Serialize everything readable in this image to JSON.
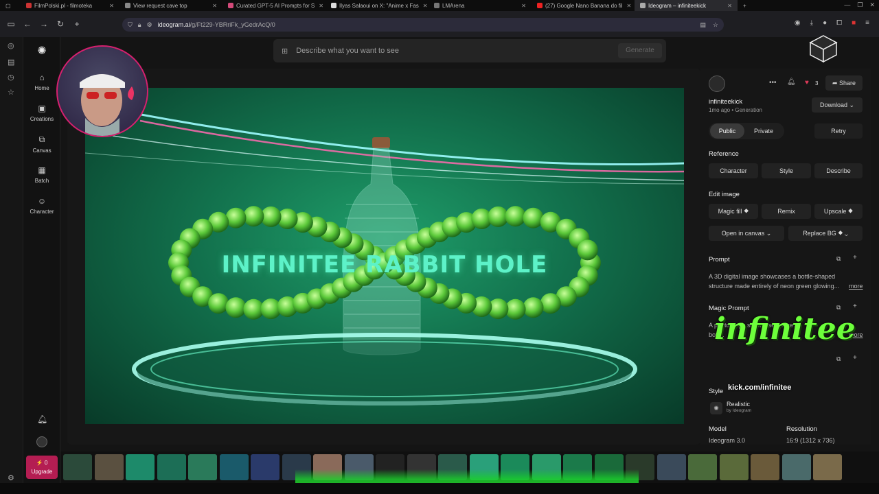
{
  "browser": {
    "tabs": [
      {
        "title": "FilmPolski.pl - filmoteka",
        "fav": "#c33"
      },
      {
        "title": "View request cave top",
        "fav": "#888"
      },
      {
        "title": "Curated GPT-5 AI Prompts for S",
        "fav": "#d44a7a"
      },
      {
        "title": "Ilyas Salaoui on X: \"Anime x Fas",
        "fav": "#ddd"
      },
      {
        "title": "LMArena",
        "fav": "#777"
      },
      {
        "title": "(27) Google Nano Banana do fil",
        "fav": "#e22"
      },
      {
        "title": "Ideogram – infiniteekick",
        "fav": "#aaa"
      }
    ],
    "url_host": "ideogram.ai",
    "url_path": "/g/Ft229-YBRriFk_yGedrAcQ/0"
  },
  "sidebar": {
    "items": [
      {
        "label": "Home",
        "icon": "home-icon",
        "glyph": "⌂"
      },
      {
        "label": "Creations",
        "icon": "image-icon",
        "glyph": "▣"
      },
      {
        "label": "Canvas",
        "icon": "canvas-icon",
        "glyph": "⧉"
      },
      {
        "label": "Batch",
        "icon": "batch-icon",
        "glyph": "▦"
      },
      {
        "label": "Character",
        "icon": "character-icon",
        "glyph": "☺"
      }
    ],
    "upgrade_count": "⚡ 0",
    "upgrade_label": "Upgrade"
  },
  "prompt": {
    "placeholder": "Describe what you want to see",
    "generate_label": "Generate"
  },
  "artwork": {
    "title": "INFINITEE RABBIT HOLE"
  },
  "panel": {
    "username": "infiniteekick",
    "meta": "1mo ago • Generation",
    "likes": "3",
    "share_label": "Share",
    "download_label": "Download",
    "public_label": "Public",
    "private_label": "Private",
    "retry_label": "Retry",
    "reference_heading": "Reference",
    "reference_buttons": [
      "Character",
      "Style",
      "Describe"
    ],
    "edit_heading": "Edit image",
    "edit_buttons": [
      "Magic fill ⯁",
      "Remix",
      "Upscale ⯁"
    ],
    "open_canvas_label": "Open in canvas",
    "replace_bg_label": "Replace BG ⯁",
    "prompt_heading": "Prompt",
    "prompt_line1": "A 3D digital image showcases a bottle-shaped",
    "prompt_line2": "structure made entirely of neon green glowing...",
    "more_label": "more",
    "magic_prompt_heading": "Magic Prompt",
    "magic_prompt_line1": "A photograph showcases a me...",
    "magic_prompt_line2": "bott...",
    "style_heading": "Style",
    "style_value": "Realistic",
    "style_by": "by Ideogram",
    "model_heading": "Model",
    "model_value": "Ideogram 3.0",
    "resolution_heading": "Resolution",
    "resolution_value": "16:9 (1312 x 736)"
  },
  "overlay": {
    "brand": "infinitee",
    "kick": "kick.com/infinitee"
  },
  "filmstrip": {
    "thumbs": [
      "#2b4a3a",
      "#5a5040",
      "#1d8a6a",
      "#1c6e56",
      "#2a7a5a",
      "#1a5a6a",
      "#2a3a6a",
      "#2a3a4a",
      "#8a6a5a",
      "#4a5a6a",
      "#222",
      "#333",
      "#2a5a4a",
      "#2aa07a",
      "#1b8a5a",
      "#2a9a6a",
      "#1b7a4a",
      "#1a6a3a",
      "#2a3a2a",
      "#3a4a5a",
      "#4a6a3a",
      "#5a6a3a",
      "#6a5a3a",
      "#4a6a6a",
      "#7a6a4a"
    ]
  }
}
